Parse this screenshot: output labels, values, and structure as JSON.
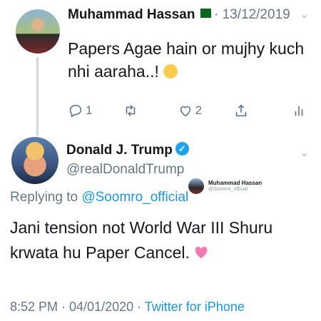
{
  "tweet1": {
    "name": "Muhammad Hassan",
    "date": "· 13/12/2019",
    "text": "Papers Agae hain or mujhy kuch nhi aaraha..!",
    "reply_count": "1",
    "like_count": "2"
  },
  "tweet2": {
    "name": "Donald J. Trump",
    "handle": "@realDonaldTrump",
    "replying_prefix": "Replying to ",
    "replying_to": "@Soomro_official",
    "text": "Jani tension not World War III Shuru krwata hu Paper Cancel.",
    "time": "8:52 PM · 04/01/2020 · ",
    "source": "Twitter for iPhone"
  },
  "overlay": {
    "name": "Muhammad Hassan",
    "handle": "@Soomro_official"
  },
  "colors": {
    "accent": "#1b95e0",
    "muted": "#657786",
    "verified": "#1da1f2"
  },
  "icons": [
    "reply-icon",
    "retweet-icon",
    "like-icon",
    "share-icon",
    "analytics-icon",
    "verified-icon",
    "chevron-down-icon",
    "pakistan-flag-icon"
  ]
}
